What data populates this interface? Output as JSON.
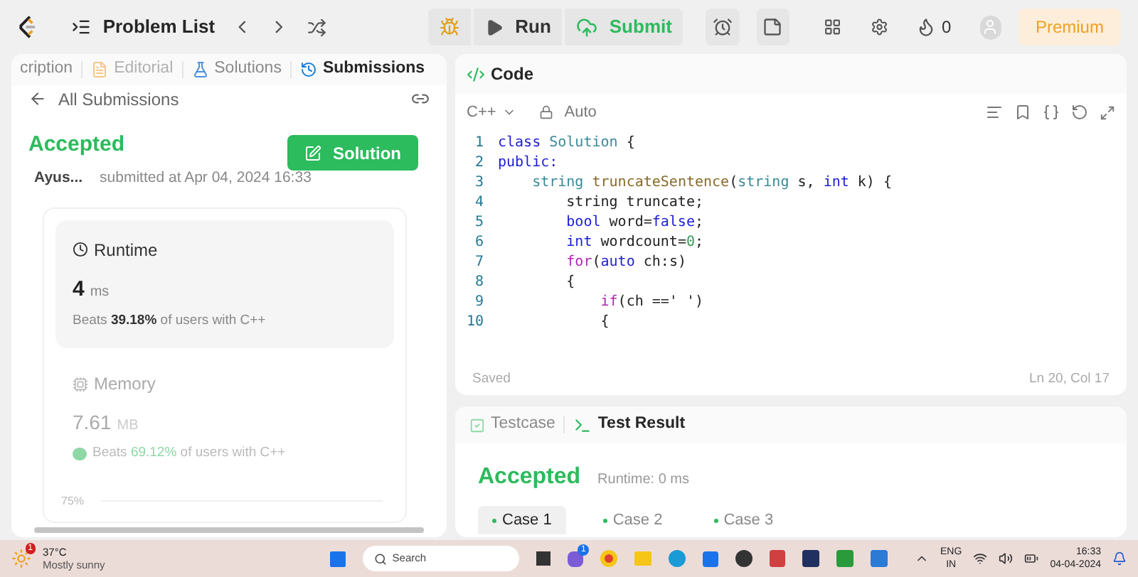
{
  "topbar": {
    "problem_list": "Problem List",
    "run": "Run",
    "submit": "Submit",
    "streak": "0",
    "premium": "Premium"
  },
  "left_panel": {
    "tabs": [
      {
        "label": "cription",
        "selected": false,
        "disabled": false
      },
      {
        "label": "Editorial",
        "selected": false,
        "disabled": true
      },
      {
        "label": "Solutions",
        "selected": false,
        "disabled": false
      },
      {
        "label": "Submissions",
        "selected": true,
        "disabled": false
      }
    ],
    "back_link": "All Submissions",
    "status": "Accepted",
    "user": "Ayus...",
    "submitted": "submitted at Apr 04, 2024 16:33",
    "solution_button": "Solution",
    "runtime": {
      "title": "Runtime",
      "value": "4",
      "unit": "ms",
      "beats": "Beats **39.18%** of users with C++"
    },
    "memory": {
      "title": "Memory",
      "value": "7.61",
      "unit": "MB",
      "beats": "Beats **69.12%** of users with C++"
    },
    "chart_tick": "75%"
  },
  "code_panel": {
    "title": "Code",
    "language": "C++",
    "mode": "Auto",
    "status": "Saved",
    "cursor": "Ln 20, Col 17",
    "lines": [
      {
        "number": "1",
        "tokens": [
          {
            "text": "class ",
            "kind": "keyword"
          },
          {
            "text": "Solution",
            "kind": "type"
          },
          {
            "text": " {",
            "kind": "plain"
          }
        ]
      },
      {
        "number": "2",
        "tokens": [
          {
            "text": "public:",
            "kind": "keyword"
          }
        ]
      },
      {
        "number": "3",
        "tokens": [
          {
            "text": "    string ",
            "kind": "type"
          },
          {
            "text": "truncateSentence",
            "kind": "function"
          },
          {
            "text": "(",
            "kind": "plain"
          },
          {
            "text": "string",
            "kind": "type"
          },
          {
            "text": " s, ",
            "kind": "plain"
          },
          {
            "text": "int",
            "kind": "keyword"
          },
          {
            "text": " k) {",
            "kind": "plain"
          }
        ]
      },
      {
        "number": "4",
        "tokens": [
          {
            "text": "        string truncate;",
            "kind": "plain"
          }
        ]
      },
      {
        "number": "5",
        "tokens": [
          {
            "text": "        bool",
            "kind": "keyword"
          },
          {
            "text": " word=",
            "kind": "plain"
          },
          {
            "text": "false",
            "kind": "keyword"
          },
          {
            "text": ";",
            "kind": "plain"
          }
        ]
      },
      {
        "number": "6",
        "tokens": [
          {
            "text": "        int",
            "kind": "keyword"
          },
          {
            "text": " wordcount=",
            "kind": "plain"
          },
          {
            "text": "0",
            "kind": "number"
          },
          {
            "text": ";",
            "kind": "plain"
          }
        ]
      },
      {
        "number": "7",
        "tokens": [
          {
            "text": "        for",
            "kind": "control"
          },
          {
            "text": "(",
            "kind": "plain"
          },
          {
            "text": "auto",
            "kind": "keyword"
          },
          {
            "text": " ch:s)",
            "kind": "plain"
          }
        ]
      },
      {
        "number": "8",
        "tokens": [
          {
            "text": "        {",
            "kind": "plain"
          }
        ]
      },
      {
        "number": "9",
        "tokens": [
          {
            "text": "            if",
            "kind": "control"
          },
          {
            "text": "(ch ==' ')",
            "kind": "plain"
          }
        ]
      },
      {
        "number": "10",
        "tokens": [
          {
            "text": "            {",
            "kind": "plain"
          }
        ]
      }
    ]
  },
  "result_panel": {
    "tabs": [
      {
        "label": "Testcase",
        "selected": false
      },
      {
        "label": "Test Result",
        "selected": true
      }
    ],
    "status": "Accepted",
    "runtime": "Runtime: 0 ms",
    "cases": [
      {
        "label": "Case 1",
        "selected": true
      },
      {
        "label": "Case 2",
        "selected": false
      },
      {
        "label": "Case 3",
        "selected": false
      }
    ]
  },
  "taskbar": {
    "weather_badge": "1",
    "temperature": "37°C",
    "weather": "Mostly sunny",
    "search": "Search",
    "chat_badge": "1",
    "language": "ENG",
    "region": "IN",
    "time": "16:33",
    "date": "04-04-2024"
  }
}
